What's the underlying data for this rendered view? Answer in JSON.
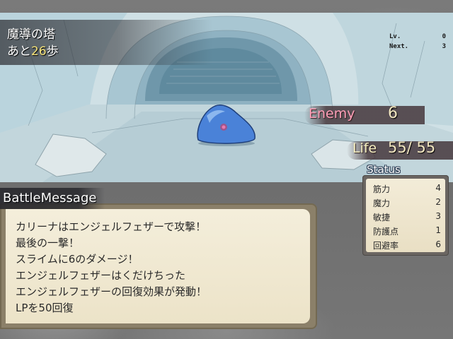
{
  "location": {
    "name": "魔導の塔",
    "steps_prefix": "あと",
    "steps_value": "26",
    "steps_suffix": "歩"
  },
  "level_info": {
    "lv_label": "Lv.",
    "lv_value": "0",
    "next_label": "Next.",
    "next_value": "3"
  },
  "enemy": {
    "label": "Enemy",
    "value": "6"
  },
  "life": {
    "label": "Life",
    "current": "55",
    "max": "55",
    "text": "55/ 55"
  },
  "status": {
    "title": "Status",
    "rows": [
      {
        "label": "筋力",
        "value": "4"
      },
      {
        "label": "魔力",
        "value": "2"
      },
      {
        "label": "敏捷",
        "value": "3"
      },
      {
        "label": "防護点",
        "value": "1"
      },
      {
        "label": "回避率",
        "value": "6"
      }
    ]
  },
  "battle_message": {
    "title": "BattleMessage",
    "lines": [
      "カリーナはエンジェルフェザーで攻撃！",
      "最後の一撃！",
      "スライムに6のダメージ！",
      "エンジェルフェザーはくだけちった",
      "エンジェルフェザーの回復効果が発動！",
      "LPを50回復"
    ]
  },
  "colors": {
    "enemy_label": "#ff9fb8",
    "steps_number": "#f4e27a",
    "slime": "#4a82d8"
  }
}
